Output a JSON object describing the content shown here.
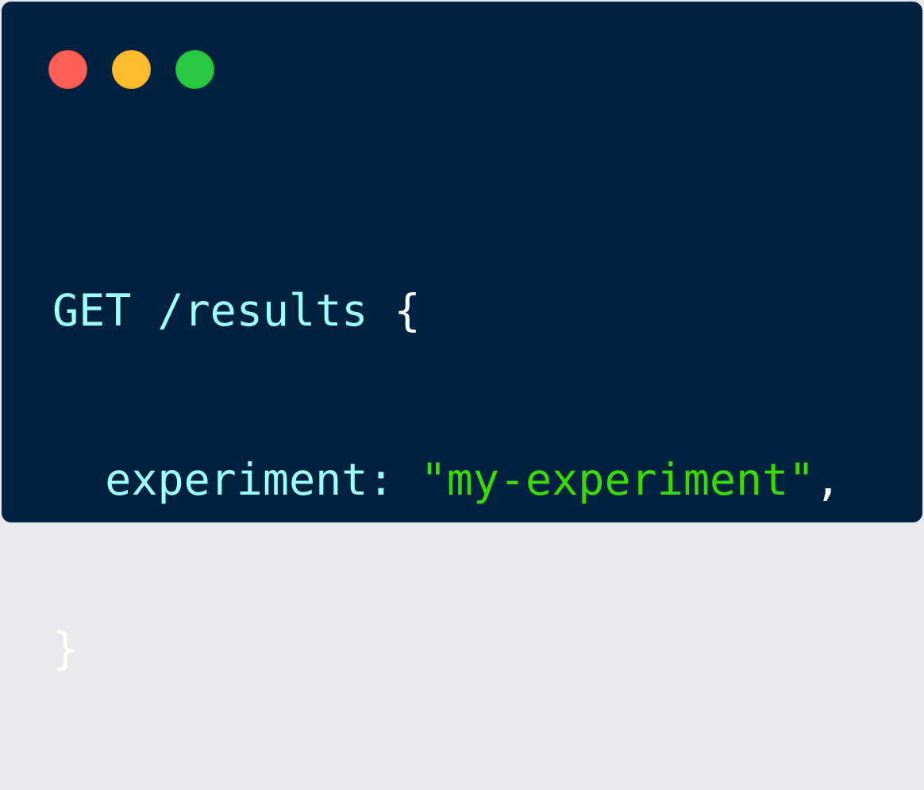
{
  "window": {
    "controls": [
      {
        "name": "close",
        "color": "#ff5f57"
      },
      {
        "name": "minimize",
        "color": "#febc2e"
      },
      {
        "name": "maximize",
        "color": "#28c840"
      }
    ],
    "background": "#002240"
  },
  "code": {
    "line1": {
      "method_path": "GET /results",
      "open_brace": "{"
    },
    "line2": {
      "indent": "  ",
      "key": "experiment:",
      "value": "\"my-experiment\"",
      "comma": ","
    },
    "line3": {
      "close_brace": "}"
    },
    "colors": {
      "keyword": "#9effff",
      "string": "#3ad900",
      "punctuation": "#ffffff"
    }
  }
}
